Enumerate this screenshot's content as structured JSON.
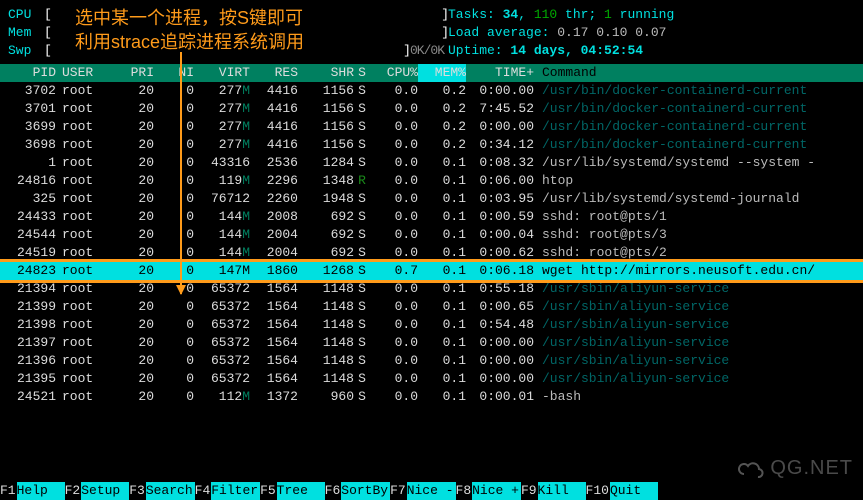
{
  "annotation": {
    "line1": "选中某一个进程，按S键即可",
    "line2": "利用strace追踪进程系统调用"
  },
  "meters": {
    "cpu_label": "CPU",
    "mem_label": "Mem",
    "swp_label": "Swp"
  },
  "sysinfo": {
    "tasks_label": "Tasks: ",
    "tasks": "34",
    "threads": "110",
    "thr": " thr; ",
    "running": "1",
    "running_lbl": " running",
    "load_label": "Load average: ",
    "load": "0.17 0.10 0.07",
    "uptime_label": "Uptime: ",
    "uptime": "14 days, 04:52:54"
  },
  "headers": {
    "pid": "PID",
    "user": "USER",
    "pri": "PRI",
    "ni": "NI",
    "virt": "VIRT",
    "res": "RES",
    "shr": "SHR",
    "s": "S",
    "cpu": "CPU%",
    "mem": "MEM%",
    "time": "TIME+",
    "cmd": "Command"
  },
  "rows": [
    {
      "pid": "3702",
      "user": "root",
      "pri": "20",
      "ni": "0",
      "virt": "277M",
      "res": "4416",
      "shr": "1156",
      "s": "S",
      "cpu": "0.0",
      "mem": "0.2",
      "time": "0:00.00",
      "cmd": "/usr/bin/docker-containerd-current",
      "dim": true
    },
    {
      "pid": "3701",
      "user": "root",
      "pri": "20",
      "ni": "0",
      "virt": "277M",
      "res": "4416",
      "shr": "1156",
      "s": "S",
      "cpu": "0.0",
      "mem": "0.2",
      "time": "7:45.52",
      "cmd": "/usr/bin/docker-containerd-current",
      "dim": true
    },
    {
      "pid": "3699",
      "user": "root",
      "pri": "20",
      "ni": "0",
      "virt": "277M",
      "res": "4416",
      "shr": "1156",
      "s": "S",
      "cpu": "0.0",
      "mem": "0.2",
      "time": "0:00.00",
      "cmd": "/usr/bin/docker-containerd-current",
      "dim": true
    },
    {
      "pid": "3698",
      "user": "root",
      "pri": "20",
      "ni": "0",
      "virt": "277M",
      "res": "4416",
      "shr": "1156",
      "s": "S",
      "cpu": "0.0",
      "mem": "0.2",
      "time": "0:34.12",
      "cmd": "/usr/bin/docker-containerd-current",
      "dim": true
    },
    {
      "pid": "1",
      "user": "root",
      "pri": "20",
      "ni": "0",
      "virt": "43316",
      "res": "2536",
      "shr": "1284",
      "s": "S",
      "cpu": "0.0",
      "mem": "0.1",
      "time": "0:08.32",
      "cmd": "/usr/lib/systemd/systemd --system -",
      "dim": false
    },
    {
      "pid": "24816",
      "user": "root",
      "pri": "20",
      "ni": "0",
      "virt": "119M",
      "res": "2296",
      "shr": "1348",
      "s": "R",
      "cpu": "0.0",
      "mem": "0.1",
      "time": "0:06.00",
      "cmd": "htop",
      "dim": false
    },
    {
      "pid": "325",
      "user": "root",
      "pri": "20",
      "ni": "0",
      "virt": "76712",
      "res": "2260",
      "shr": "1948",
      "s": "S",
      "cpu": "0.0",
      "mem": "0.1",
      "time": "0:03.95",
      "cmd": "/usr/lib/systemd/systemd-journald",
      "dim": false
    },
    {
      "pid": "24433",
      "user": "root",
      "pri": "20",
      "ni": "0",
      "virt": "144M",
      "res": "2008",
      "shr": "692",
      "s": "S",
      "cpu": "0.0",
      "mem": "0.1",
      "time": "0:00.59",
      "cmd": "sshd: root@pts/1",
      "dim": false
    },
    {
      "pid": "24544",
      "user": "root",
      "pri": "20",
      "ni": "0",
      "virt": "144M",
      "res": "2004",
      "shr": "692",
      "s": "S",
      "cpu": "0.0",
      "mem": "0.1",
      "time": "0:00.04",
      "cmd": "sshd: root@pts/3",
      "dim": false
    },
    {
      "pid": "24519",
      "user": "root",
      "pri": "20",
      "ni": "0",
      "virt": "144M",
      "res": "2004",
      "shr": "692",
      "s": "S",
      "cpu": "0.0",
      "mem": "0.1",
      "time": "0:00.62",
      "cmd": "sshd: root@pts/2",
      "dim": false
    },
    {
      "pid": "24823",
      "user": "root",
      "pri": "20",
      "ni": "0",
      "virt": "147M",
      "res": "1860",
      "shr": "1268",
      "s": "S",
      "cpu": "0.7",
      "mem": "0.1",
      "time": "0:06.18",
      "cmd": "wget http://mirrors.neusoft.edu.cn/",
      "dim": false,
      "sel": true
    },
    {
      "pid": "21394",
      "user": "root",
      "pri": "20",
      "ni": "0",
      "virt": "65372",
      "res": "1564",
      "shr": "1148",
      "s": "S",
      "cpu": "0.0",
      "mem": "0.1",
      "time": "0:55.18",
      "cmd": "/usr/sbin/aliyun-service",
      "dim": true
    },
    {
      "pid": "21399",
      "user": "root",
      "pri": "20",
      "ni": "0",
      "virt": "65372",
      "res": "1564",
      "shr": "1148",
      "s": "S",
      "cpu": "0.0",
      "mem": "0.1",
      "time": "0:00.65",
      "cmd": "/usr/sbin/aliyun-service",
      "dim": true
    },
    {
      "pid": "21398",
      "user": "root",
      "pri": "20",
      "ni": "0",
      "virt": "65372",
      "res": "1564",
      "shr": "1148",
      "s": "S",
      "cpu": "0.0",
      "mem": "0.1",
      "time": "0:54.48",
      "cmd": "/usr/sbin/aliyun-service",
      "dim": true
    },
    {
      "pid": "21397",
      "user": "root",
      "pri": "20",
      "ni": "0",
      "virt": "65372",
      "res": "1564",
      "shr": "1148",
      "s": "S",
      "cpu": "0.0",
      "mem": "0.1",
      "time": "0:00.00",
      "cmd": "/usr/sbin/aliyun-service",
      "dim": true
    },
    {
      "pid": "21396",
      "user": "root",
      "pri": "20",
      "ni": "0",
      "virt": "65372",
      "res": "1564",
      "shr": "1148",
      "s": "S",
      "cpu": "0.0",
      "mem": "0.1",
      "time": "0:00.00",
      "cmd": "/usr/sbin/aliyun-service",
      "dim": true
    },
    {
      "pid": "21395",
      "user": "root",
      "pri": "20",
      "ni": "0",
      "virt": "65372",
      "res": "1564",
      "shr": "1148",
      "s": "S",
      "cpu": "0.0",
      "mem": "0.1",
      "time": "0:00.00",
      "cmd": "/usr/sbin/aliyun-service",
      "dim": true
    },
    {
      "pid": "24521",
      "user": "root",
      "pri": "20",
      "ni": "0",
      "virt": "112M",
      "res": "1372",
      "shr": "960",
      "s": "S",
      "cpu": "0.0",
      "mem": "0.1",
      "time": "0:00.01",
      "cmd": "-bash",
      "dim": false
    }
  ],
  "fkeys": [
    {
      "k": "F1",
      "n": "Help"
    },
    {
      "k": "F2",
      "n": "Setup"
    },
    {
      "k": "F3",
      "n": "Search"
    },
    {
      "k": "F4",
      "n": "Filter"
    },
    {
      "k": "F5",
      "n": "Tree"
    },
    {
      "k": "F6",
      "n": "SortBy"
    },
    {
      "k": "F7",
      "n": "Nice -"
    },
    {
      "k": "F8",
      "n": "Nice +"
    },
    {
      "k": "F9",
      "n": "Kill"
    },
    {
      "k": "F10",
      "n": "Quit"
    }
  ],
  "watermark": "QG.NET"
}
